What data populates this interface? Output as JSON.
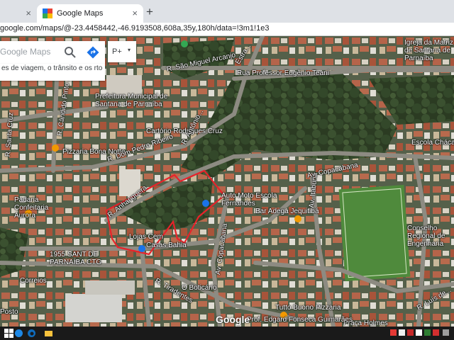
{
  "browser": {
    "tabs": [
      {
        "title": "",
        "close": "×"
      },
      {
        "title": "Google Maps",
        "close": "×"
      }
    ],
    "new_tab": "+",
    "url": "google.com/maps/@-23.4458442,-46.9193508,608a,35y,180h/data=!3m1!1e3"
  },
  "search": {
    "placeholder": "Google Maps",
    "hint": "es de viagem, o trânsito e os rto",
    "pill": "P+",
    "pill_caret": "▾",
    "icons": [
      "search-icon",
      "directions-icon"
    ]
  },
  "map": {
    "google_logo": "Google",
    "labels": {
      "sao_miguel": "R. São Miguel Arcanjo",
      "estra": "Estra...",
      "igreja": "Igreja da Matriz de Santana de Parnaíba",
      "eugenio": "Rua Professor Eugênio Teani",
      "prefeitura": "Prefeitura Municipal de Santana de Parnaíba",
      "cartorio": "Cartório Rodrigues Cruz",
      "candido": "R. Cândido Pinto Parrotti",
      "sta_cruz": "R. Santa Cruz",
      "pizzaria_bona": "Pizzaria Bona Notte",
      "dpedro": "R. Dom Pedro Ribeiro",
      "antonio": "R. Antônio...",
      "escola_chaca": "Escola Chácar",
      "copacabana": "Av. Copacabana",
      "auto_moto": "Auto Moto Escola Fernandes",
      "bar_adega": "Bar Adega Jequitibá",
      "itabuna": "Av. Itabuna",
      "padaria": "Padaria Confeitaria Aurora",
      "anhanguera": "R. Anhanguera",
      "lojas": "Lojas Cem",
      "casas_bahia": "Casas Bahia",
      "conselho": "Conselho Regional de Engenharia",
      "sant_parnaiba": "1955 SANT DE PARNAÍBA CTG",
      "correios": "Correios",
      "boticario": "O Boticário",
      "tutto": "Tutto Buono Pizzaria",
      "praca": "Praça Holmes",
      "tiradentes": "R. Tiradentes",
      "posto": "Posto",
      "av_copa2": "Av. Copacabana",
      "rua_la": "R. Luís de...",
      "pof": "Prof. Edgard Fonseca Guimarães"
    }
  },
  "taskbar": {
    "icons": [
      "windows-start-icon",
      "search-icon",
      "edge-icon",
      "file-explorer-icon",
      "store-icon",
      "chrome-icon"
    ]
  }
}
